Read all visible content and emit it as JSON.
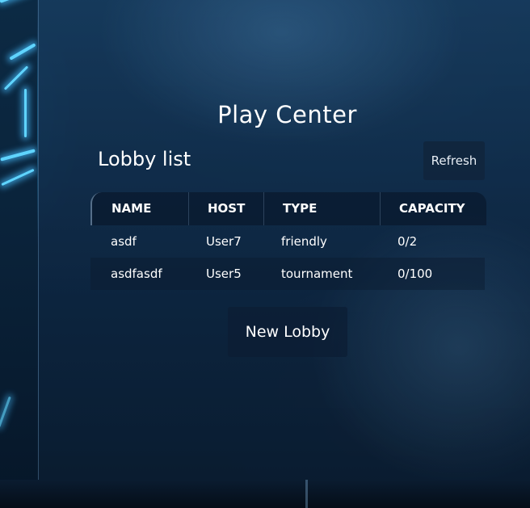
{
  "page": {
    "title": "Play Center"
  },
  "lobby": {
    "heading": "Lobby list",
    "refresh_label": "Refresh",
    "new_lobby_label": "New Lobby",
    "columns": [
      "NAME",
      "HOST",
      "TYPE",
      "CAPACITY"
    ],
    "rows": [
      {
        "name": "asdf",
        "host": "User7",
        "type": "friendly",
        "capacity": "0/2"
      },
      {
        "name": "asdfasdf",
        "host": "User5",
        "type": "tournament",
        "capacity": "0/100"
      }
    ]
  },
  "colors": {
    "accent_glow": "#5fd4ff",
    "panel": "#163a5c",
    "text": "#ffffff"
  }
}
